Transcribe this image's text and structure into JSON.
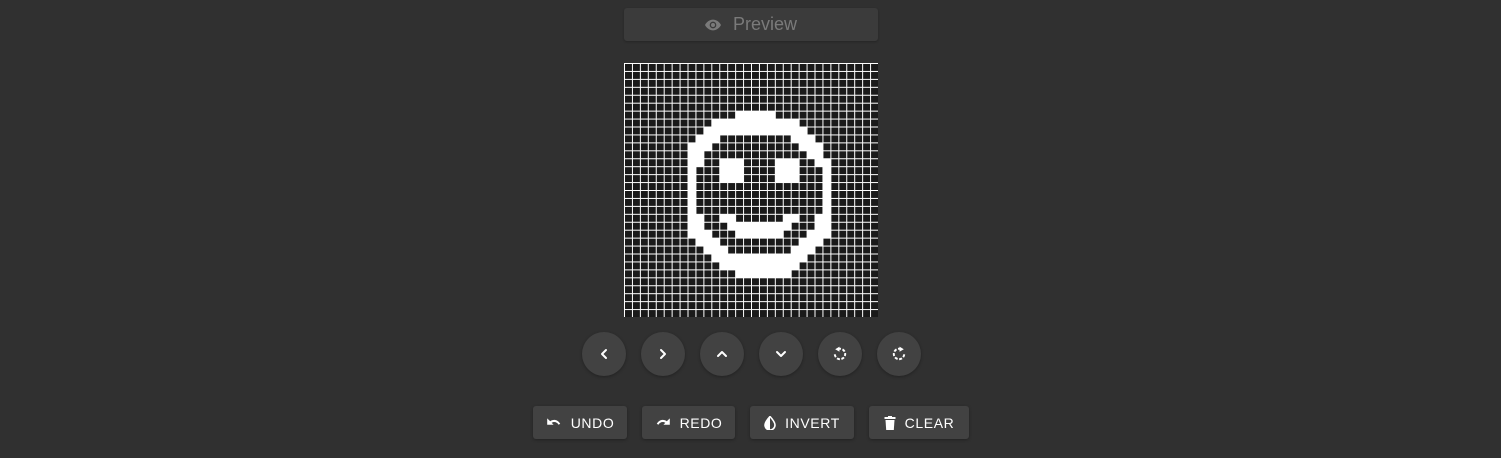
{
  "preview": {
    "label": "Preview",
    "icon": "eye-icon",
    "text_color": "#7a7a7a",
    "disabled": true
  },
  "grid": {
    "columns": 32,
    "rows": 32,
    "on_color": "#ffffff",
    "off_color": "#1a1a1a",
    "line_color": "#ffffff",
    "pattern": [
      "................................",
      "................................",
      "................................",
      "................................",
      "................................",
      "................................",
      "..............*****.............",
      "...........***********..........",
      "..........*************.........",
      ".........***.........***........",
      "........***...........***.......",
      "........**.............**.......",
      "........**..***....***..**......",
      "........*...***....***...*......",
      "........*...***....***...*......",
      "........*................*......",
      "........*................*......",
      "........*................*......",
      "........*................*......",
      "........**..**......**..**......",
      "........**...********...**......",
      "........***...******...***......",
      ".........***..........***.......",
      "..........***........***........",
      "...........************.........",
      "............**********..........",
      "..............*******...........",
      "................................",
      "................................",
      "................................",
      "................................",
      "................................"
    ]
  },
  "controls": [
    {
      "id": "shift-left",
      "icon": "chevron-left-icon"
    },
    {
      "id": "shift-right",
      "icon": "chevron-right-icon"
    },
    {
      "id": "shift-up",
      "icon": "chevron-up-icon"
    },
    {
      "id": "shift-down",
      "icon": "chevron-down-icon"
    },
    {
      "id": "rotate-left",
      "icon": "rotate-left-icon"
    },
    {
      "id": "rotate-right",
      "icon": "rotate-right-icon"
    }
  ],
  "actions": {
    "undo": {
      "label": "UNDO",
      "icon": "undo-icon"
    },
    "redo": {
      "label": "REDO",
      "icon": "redo-icon"
    },
    "invert": {
      "label": "INVERT",
      "icon": "invert-drop-icon"
    },
    "clear": {
      "label": "CLEAR",
      "icon": "trash-icon"
    }
  }
}
